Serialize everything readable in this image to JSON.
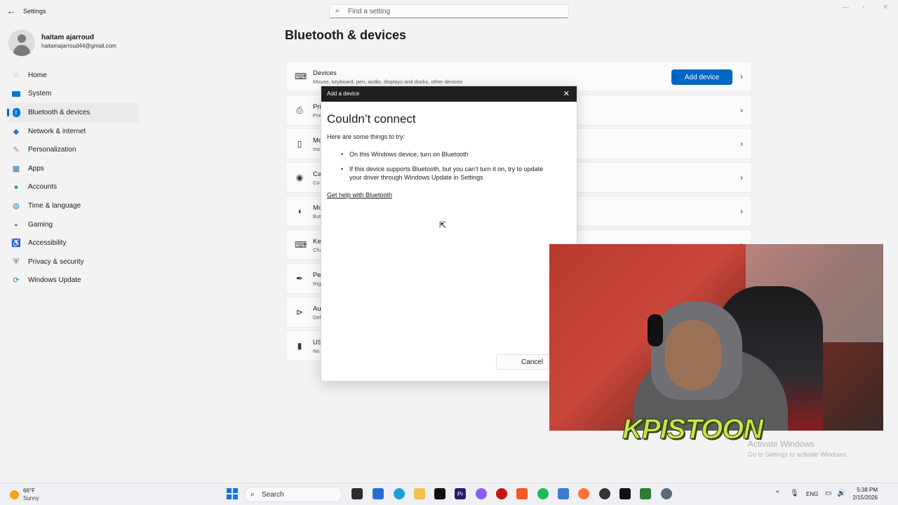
{
  "app": {
    "title": "Settings",
    "back_icon": "back-arrow-icon",
    "search_placeholder": "Find a setting"
  },
  "profile": {
    "name": "haitam ajarroud",
    "email": "haitamajarroud44@gmail.com"
  },
  "sidebar": {
    "items": [
      {
        "label": "Home",
        "icon": "home-icon",
        "color": "#e8912d"
      },
      {
        "label": "System",
        "icon": "system-icon",
        "color": "#0078d4"
      },
      {
        "label": "Bluetooth & devices",
        "icon": "bluetooth-icon",
        "color": "#0078d4",
        "active": true
      },
      {
        "label": "Network & internet",
        "icon": "wifi-icon",
        "color": "#1f7ad6"
      },
      {
        "label": "Personalization",
        "icon": "brush-icon",
        "color": "#e26a2c"
      },
      {
        "label": "Apps",
        "icon": "apps-icon",
        "color": "#3a6ea5"
      },
      {
        "label": "Accounts",
        "icon": "accounts-icon",
        "color": "#2aa772"
      },
      {
        "label": "Time & language",
        "icon": "globe-clock-icon",
        "color": "#1e88c8"
      },
      {
        "label": "Gaming",
        "icon": "gamepad-icon",
        "color": "#6b6b6b"
      },
      {
        "label": "Accessibility",
        "icon": "accessibility-icon",
        "color": "#1565c0"
      },
      {
        "label": "Privacy & security",
        "icon": "shield-icon",
        "color": "#6b6b6b"
      },
      {
        "label": "Windows Update",
        "icon": "update-icon",
        "color": "#1e88c8"
      }
    ]
  },
  "main": {
    "title": "Bluetooth & devices",
    "cards": [
      {
        "title": "Devices",
        "subtitle": "Mouse, keyboard, pen, audio, displays and docks, other devices",
        "icon": "devices-icon",
        "button": "Add device"
      },
      {
        "title": "Pri",
        "subtitle": "Pre",
        "icon": "printer-icon"
      },
      {
        "title": "Mo",
        "subtitle": "Ins",
        "icon": "phone-icon"
      },
      {
        "title": "Ca",
        "subtitle": "Co",
        "icon": "camera-icon"
      },
      {
        "title": "Mo",
        "subtitle": "Butt",
        "icon": "mouse-icon"
      },
      {
        "title": "Key",
        "subtitle": "Cha",
        "icon": "keyboard-icon"
      },
      {
        "title": "Pen",
        "subtitle": "Rig",
        "icon": "pen-icon"
      },
      {
        "title": "Au",
        "subtitle": "Def",
        "icon": "autoplay-icon"
      },
      {
        "title": "US",
        "subtitle": "No",
        "icon": "usb-icon"
      }
    ]
  },
  "dialog": {
    "title": "Add a device",
    "heading": "Couldn’t connect",
    "intro": "Here are some things to try:",
    "tips": [
      "On this Windows device, turn on Bluetooth",
      "If this device supports Bluetooth, but you can’t turn it on, try to update your driver through Windows Update in Settings"
    ],
    "help_link": "Get help with Bluetooth",
    "cancel_label": "Cancel"
  },
  "overlay": {
    "brand": "KPISTOON",
    "activate_title": "Activate Windows",
    "activate_sub": "Go to Settings to activate Windows."
  },
  "taskbar": {
    "weather_temp": "66°F",
    "weather_desc": "Sunny",
    "search_label": "Search",
    "language": "ENG",
    "time": "5:38 PM",
    "date": "2/15/2026",
    "apps": [
      {
        "name": "file-explorer-icon",
        "color": "#f2c14e"
      },
      {
        "name": "edge-icon",
        "color": "#1a9fd9"
      },
      {
        "name": "microsoft-store-icon",
        "color": "#2b6cd4"
      },
      {
        "name": "capcut-icon",
        "color": "#111111"
      },
      {
        "name": "premiere-icon",
        "color": "#2a1a6e"
      },
      {
        "name": "copilot-icon",
        "color": "#8a5cf6"
      },
      {
        "name": "red-app-icon",
        "color": "#c81414"
      },
      {
        "name": "brave-icon",
        "color": "#f05a24"
      },
      {
        "name": "spotify-icon",
        "color": "#1db954"
      },
      {
        "name": "notepad-icon",
        "color": "#3a7bd5"
      },
      {
        "name": "firefox-icon",
        "color": "#ff7139"
      },
      {
        "name": "obs-icon",
        "color": "#333333"
      },
      {
        "name": "capcut-active-icon",
        "color": "#111111"
      },
      {
        "name": "terminal-icon",
        "color": "#2e7d32"
      },
      {
        "name": "settings-icon",
        "color": "#5a6a7a"
      }
    ]
  }
}
